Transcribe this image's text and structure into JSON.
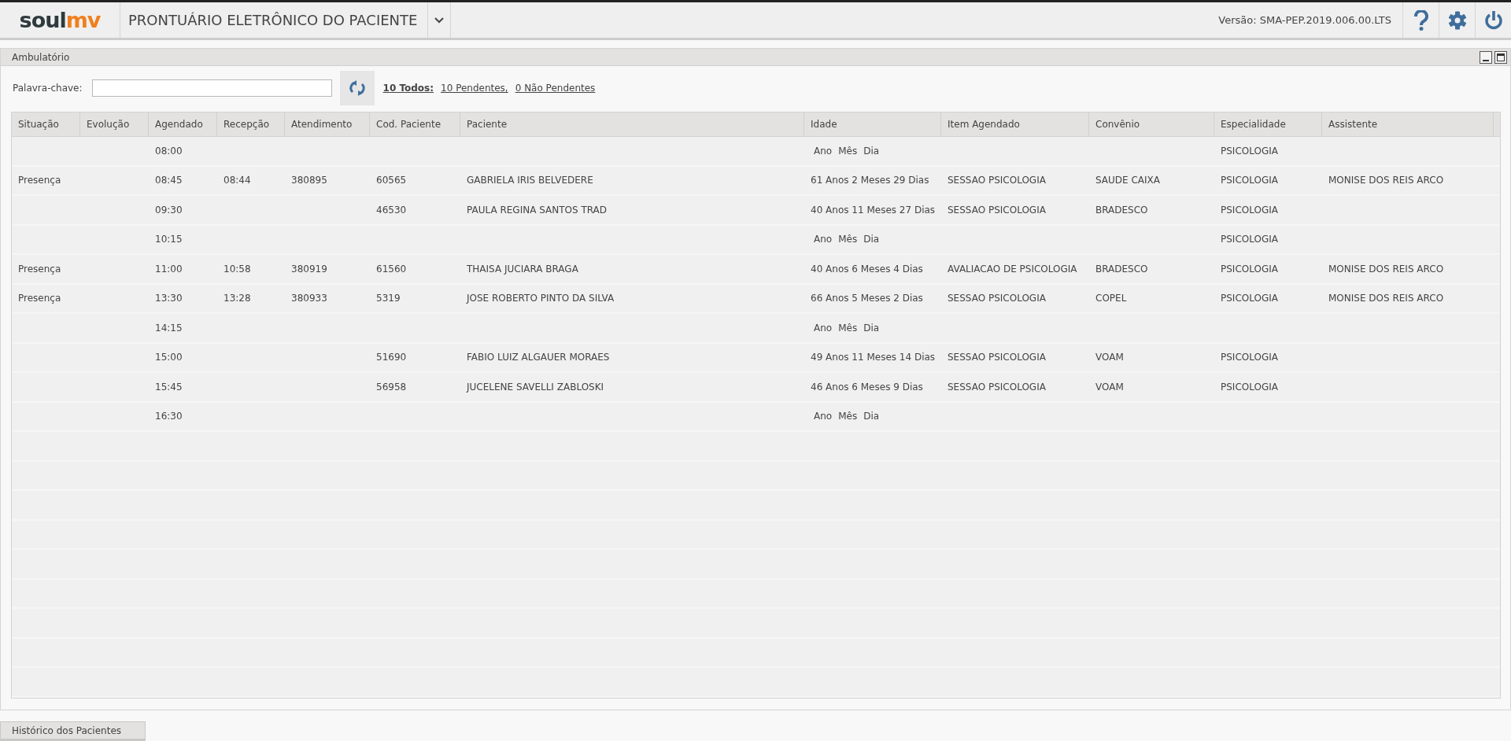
{
  "header": {
    "logo": {
      "dark": "soul",
      "accent": "mv"
    },
    "title": "PRONTUÁRIO ELETRÔNICO DO PACIENTE",
    "version": "Versão: SMA-PEP.2019.006.00.LTS"
  },
  "panel": {
    "title": "Ambulatório",
    "search": {
      "label": "Palavra-chave:"
    },
    "filters": [
      {
        "label": "10 Todos:",
        "selected": true
      },
      {
        "label": "10 Pendentes,",
        "selected": false
      },
      {
        "label": "0 Não Pendentes",
        "selected": false
      }
    ],
    "table": {
      "columns": [
        "Situação",
        "Evolução",
        "Agendado",
        "Recepção",
        "Atendimento",
        "Cod. Paciente",
        "Paciente",
        "Idade",
        "Item Agendado",
        "Convênio",
        "Especialidade",
        "Assistente"
      ],
      "rows": [
        {
          "agendado": "08:00",
          "idade_units": [
            "Ano",
            "Mês",
            "Dia"
          ],
          "especialidade": "PSICOLOGIA"
        },
        {
          "situacao": "Presença",
          "agendado": "08:45",
          "recepcao": "08:44",
          "atendimento": "380895",
          "cod": "60565",
          "paciente": "GABRIELA IRIS BELVEDERE",
          "idade": "61 Anos 2 Meses 29 Dias",
          "item": "SESSAO PSICOLOGIA",
          "convenio": "SAUDE CAIXA",
          "especialidade": "PSICOLOGIA",
          "assistente": "MONISE DOS REIS ARCO"
        },
        {
          "agendado": "09:30",
          "cod": "46530",
          "paciente": "PAULA REGINA SANTOS TRAD",
          "idade": "40 Anos 11 Meses 27 Dias",
          "item": "SESSAO PSICOLOGIA",
          "convenio": "BRADESCO",
          "especialidade": "PSICOLOGIA"
        },
        {
          "agendado": "10:15",
          "idade_units": [
            "Ano",
            "Mês",
            "Dia"
          ],
          "especialidade": "PSICOLOGIA"
        },
        {
          "situacao": "Presença",
          "agendado": "11:00",
          "recepcao": "10:58",
          "atendimento": "380919",
          "cod": "61560",
          "paciente": "THAISA JUCIARA BRAGA",
          "idade": "40 Anos 6 Meses 4 Dias",
          "item": "AVALIACAO DE PSICOLOGIA",
          "convenio": "BRADESCO",
          "especialidade": "PSICOLOGIA",
          "assistente": "MONISE DOS REIS ARCO"
        },
        {
          "situacao": "Presença",
          "agendado": "13:30",
          "recepcao": "13:28",
          "atendimento": "380933",
          "cod": "5319",
          "paciente": "JOSE ROBERTO PINTO DA SILVA",
          "idade": "66 Anos 5 Meses 2 Dias",
          "item": "SESSAO PSICOLOGIA",
          "convenio": "COPEL",
          "especialidade": "PSICOLOGIA",
          "assistente": "MONISE DOS REIS ARCO"
        },
        {
          "agendado": "14:15",
          "idade_units": [
            "Ano",
            "Mês",
            "Dia"
          ]
        },
        {
          "agendado": "15:00",
          "cod": "51690",
          "paciente": "FABIO LUIZ ALGAUER MORAES",
          "idade": "49 Anos 11 Meses 14 Dias",
          "item": "SESSAO PSICOLOGIA",
          "convenio": "VOAM",
          "especialidade": "PSICOLOGIA"
        },
        {
          "agendado": "15:45",
          "cod": "56958",
          "paciente": "JUCELENE SAVELLI ZABLOSKI",
          "idade": "46 Anos 6 Meses 9 Dias",
          "item": "SESSAO PSICOLOGIA",
          "convenio": "VOAM",
          "especialidade": "PSICOLOGIA"
        },
        {
          "agendado": "16:30",
          "idade_units": [
            "Ano",
            "Mês",
            "Dia"
          ]
        }
      ]
    }
  },
  "bottom_tab": {
    "label": "Histórico dos Pacientes"
  }
}
